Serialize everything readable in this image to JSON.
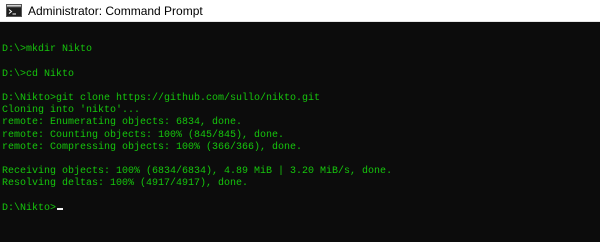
{
  "window": {
    "title": "Administrator: Command Prompt",
    "icon": "cmd-icon"
  },
  "console": {
    "text_color": "#16c60c",
    "background": "#0c0c0c",
    "lines": [
      "",
      "D:\\>mkdir Nikto",
      "",
      "D:\\>cd Nikto",
      "",
      "D:\\Nikto>git clone https://github.com/sullo/nikto.git",
      "Cloning into 'nikto'...",
      "remote: Enumerating objects: 6834, done.",
      "remote: Counting objects: 100% (845/845), done.",
      "remote: Compressing objects: 100% (366/366), done.",
      "",
      "Receiving objects: 100% (6834/6834), 4.89 MiB | 3.20 MiB/s, done.",
      "Resolving deltas: 100% (4917/4917), done.",
      "",
      "D:\\Nikto>"
    ]
  }
}
